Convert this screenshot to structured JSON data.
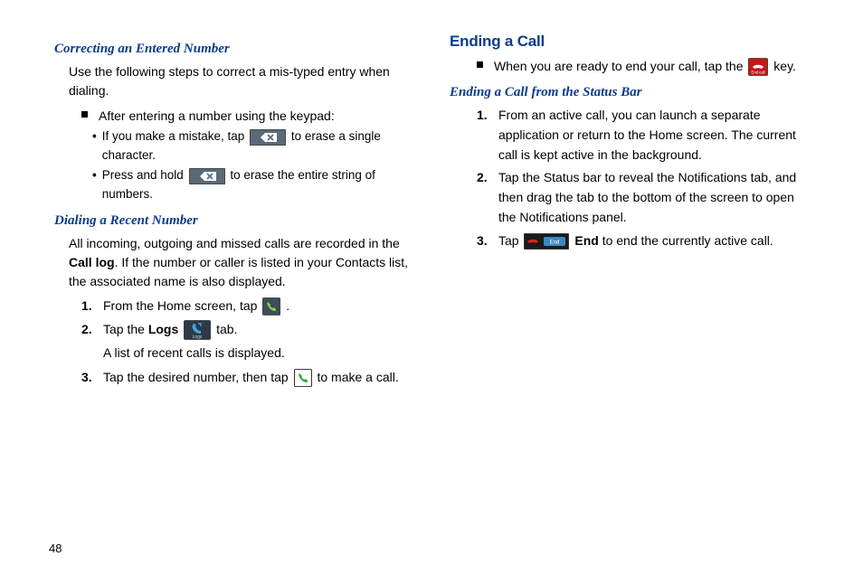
{
  "pageNumber": "48",
  "left": {
    "sub1": {
      "heading": "Correcting an Entered Number",
      "intro": "Use the following steps to correct a mis-typed entry when dialing.",
      "bullet": "After entering a number using the keypad:",
      "sb1a": "If you make a mistake, tap ",
      "sb1b": " to erase a single character.",
      "sb2a": "Press and hold ",
      "sb2b": " to erase the entire string of numbers."
    },
    "sub2": {
      "heading": "Dialing a Recent Number",
      "intro1": "All incoming, outgoing and missed calls are recorded in the ",
      "intro1bold": "Call log",
      "intro1b": ". If the number or caller is listed in your Contacts list, the associated name is also displayed.",
      "s1n": "1.",
      "s1a": "From the Home screen, tap ",
      "s1b": ".",
      "s2n": "2.",
      "s2a": "Tap the ",
      "s2bold": "Logs",
      "s2b": " ",
      "s2c": " tab.",
      "s2after": "A list of recent calls is displayed.",
      "s3n": "3.",
      "s3a": "Tap the desired number, then tap ",
      "s3b": " to make a call."
    }
  },
  "right": {
    "heading": "Ending a Call",
    "bullet_a": "When you are ready to end your call, tap the ",
    "bullet_b": " key.",
    "sub1": {
      "heading": "Ending a Call from the Status Bar",
      "s1n": "1.",
      "s1": "From an active call, you can launch a separate application or return to the Home screen. The current call is kept active in the background.",
      "s2n": "2.",
      "s2": "Tap the Status bar to reveal the Notifications tab, and then drag the tab to the bottom of the screen to open the Notifications panel.",
      "s3n": "3.",
      "s3a": "Tap ",
      "s3b": " ",
      "s3bold": "End",
      "s3c": " to end the currently active call."
    }
  }
}
